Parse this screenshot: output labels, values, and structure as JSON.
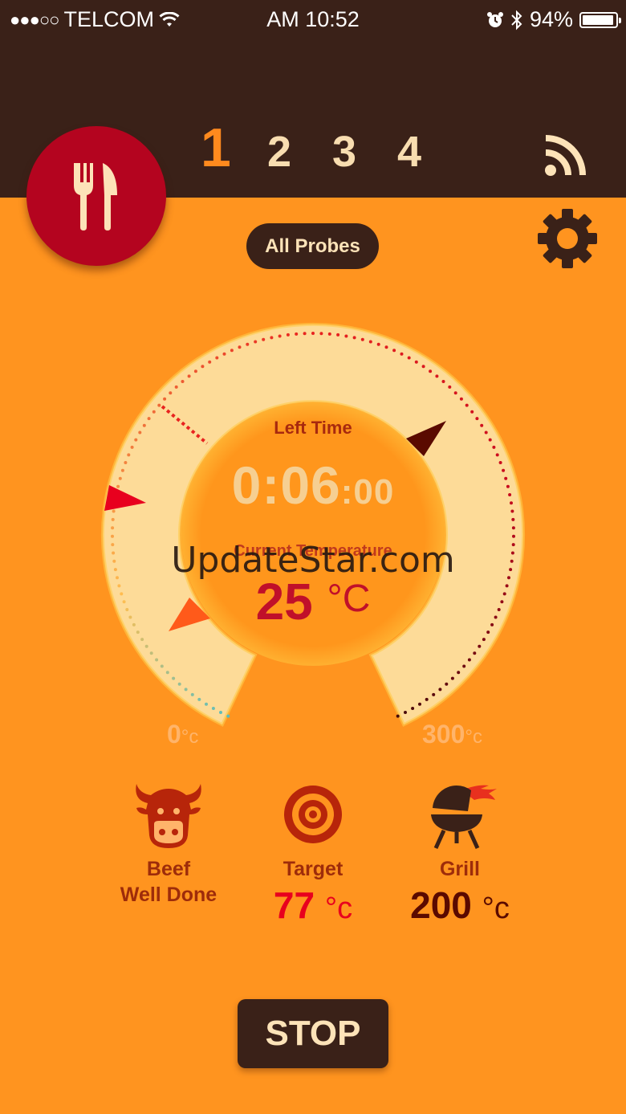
{
  "status_bar": {
    "signal": "●●●○○",
    "carrier": "TELCOM",
    "time": "AM 10:52",
    "battery": "94%",
    "battery_level": 0.94
  },
  "header": {
    "probe_tabs": [
      "1",
      "2",
      "3",
      "4"
    ],
    "active_probe": "1"
  },
  "controls": {
    "all_probes_label": "All Probes",
    "stop_label": "STOP"
  },
  "gauge": {
    "left_time_label": "Left Time",
    "left_time_main": "0:06",
    "left_time_secs": ":00",
    "current_temp_label": "Current Temperature",
    "current_temp": "25",
    "unit": "°C",
    "scale_min": "0",
    "scale_max": "300",
    "scale_unit": "°c"
  },
  "info": {
    "meat": {
      "label_line1": "Beef",
      "label_line2": "Well Done"
    },
    "target": {
      "label": "Target",
      "value": "77",
      "unit": "°c",
      "color": "#e8001e"
    },
    "grill": {
      "label": "Grill",
      "value": "200",
      "unit": "°c",
      "color": "#5a0a00"
    }
  },
  "watermark": "UpdateStar.com",
  "colors": {
    "header_bg": "#3a2118",
    "body_bg": "#ff941f",
    "accent_red": "#b4041f",
    "gauge_ring": "#fddb98"
  },
  "icons": {
    "menu": "fork-knife-icon",
    "feed": "rss-feed-icon",
    "settings": "gear-icon",
    "meat": "cow-icon",
    "target": "target-icon",
    "grill": "bbq-grill-icon"
  }
}
